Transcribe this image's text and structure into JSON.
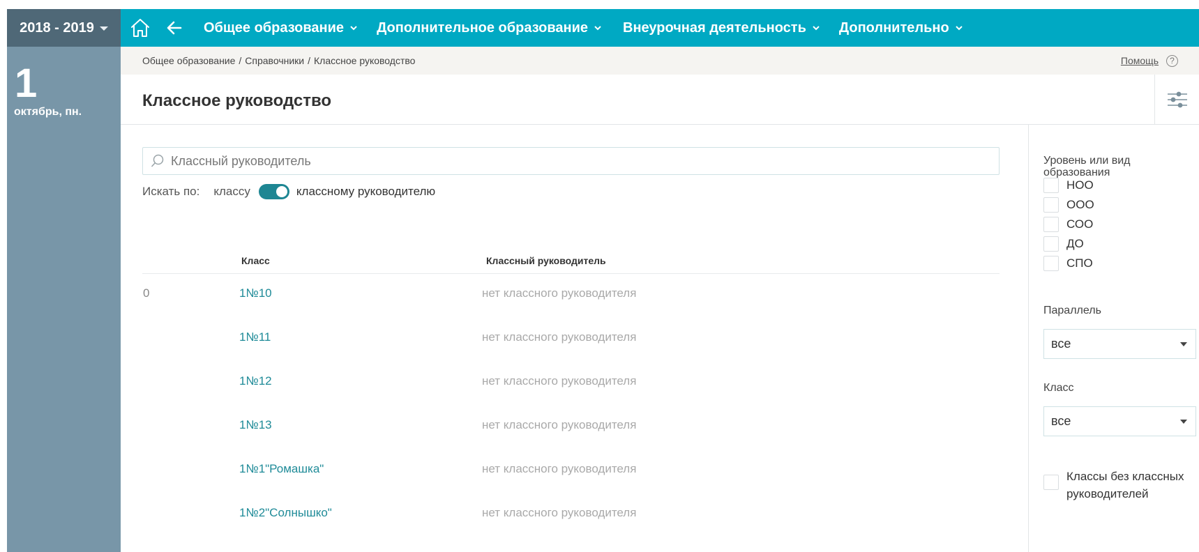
{
  "sidebar": {
    "year": "2018 - 2019",
    "day": "1",
    "date_label": "октябрь, пн."
  },
  "topnav": {
    "menus": [
      {
        "label": "Общее образование"
      },
      {
        "label": "Дополнительное образование"
      },
      {
        "label": "Внеурочная деятельность"
      },
      {
        "label": "Дополнительно"
      }
    ]
  },
  "breadcrumb": {
    "items": [
      "Общее образование",
      "Справочники",
      "Классное руководство"
    ],
    "separator": "/"
  },
  "help": {
    "label": "Помощь",
    "icon": "?"
  },
  "page": {
    "title": "Классное руководство"
  },
  "search": {
    "placeholder": "Классный руководитель",
    "value": "",
    "by_label": "Искать по:",
    "option_class": "классу",
    "option_teacher": "классному руководителю",
    "toggle_on": true
  },
  "table": {
    "headers": {
      "class": "Класс",
      "teacher": "Классный руководитель"
    },
    "rows": [
      {
        "num": "0",
        "class": "1№10",
        "teacher": "нет классного руководителя"
      },
      {
        "num": "",
        "class": "1№11",
        "teacher": "нет классного руководителя"
      },
      {
        "num": "",
        "class": "1№12",
        "teacher": "нет классного руководителя"
      },
      {
        "num": "",
        "class": "1№13",
        "teacher": "нет классного руководителя"
      },
      {
        "num": "",
        "class": "1№1\"Ромашка\"",
        "teacher": "нет классного руководителя"
      },
      {
        "num": "",
        "class": "1№2\"Солнышко\"",
        "teacher": "нет классного руководителя"
      }
    ]
  },
  "filters": {
    "level_label": "Уровень или вид образования",
    "levels": [
      {
        "label": "НОО",
        "checked": false
      },
      {
        "label": "ООО",
        "checked": false
      },
      {
        "label": "СОО",
        "checked": false
      },
      {
        "label": "ДО",
        "checked": false
      },
      {
        "label": "СПО",
        "checked": false
      }
    ],
    "parallel_label": "Параллель",
    "parallel_value": "все",
    "class_label": "Класс",
    "class_value": "все",
    "no_teacher_label": "Классы без классных руководителей",
    "no_teacher_checked": false
  },
  "colors": {
    "topnav": "#00a9c3",
    "sidebar": "#7896a8",
    "year_box": "#4f6877",
    "link": "#1f8b98",
    "toggle": "#1e8693"
  }
}
